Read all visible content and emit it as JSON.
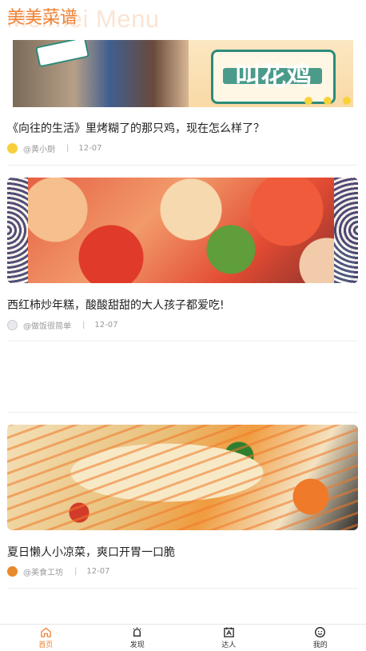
{
  "app": {
    "title": "美美菜谱",
    "watermark": "Meimei Menu",
    "accent_color": "#f08234"
  },
  "feed": [
    {
      "title": "《向往的生活》里烤糊了的那只鸡，现在怎么样了？",
      "author": "@黄小厨",
      "date": "12-07",
      "banner_text": "叫花鸡"
    },
    {
      "title": "西红柿炒年糕，酸酸甜甜的大人孩子都爱吃!",
      "author": "@做饭很简单",
      "date": "12-07"
    },
    {
      "title": "夏日懒人小凉菜，爽口开胃一口脆",
      "author": "@美食工坊",
      "date": "12-07"
    }
  ],
  "tabs": [
    {
      "label": "首页",
      "icon": "home-icon",
      "active": true
    },
    {
      "label": "发现",
      "icon": "discover-icon",
      "active": false
    },
    {
      "label": "达人",
      "icon": "expert-icon",
      "active": false
    },
    {
      "label": "我的",
      "icon": "profile-icon",
      "active": false
    }
  ]
}
